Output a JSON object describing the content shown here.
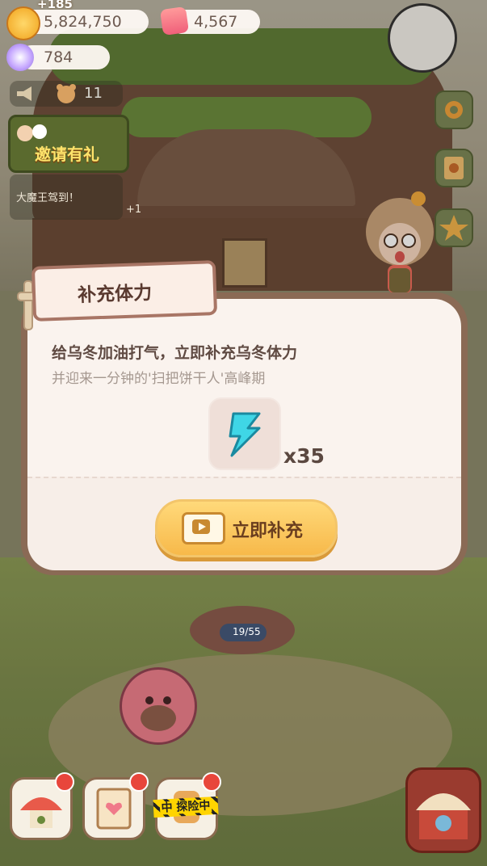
{
  "resources": {
    "gain_popup": "+185",
    "coins": "5,824,750",
    "gems": "4,567",
    "orbs": "784"
  },
  "left_panel": {
    "notice_count": "11",
    "invite_label": "邀请有礼",
    "chat_message": "大魔王驾到！",
    "chat_plus": "+1"
  },
  "dialog": {
    "title": "补充体力",
    "description": "给乌冬加油打气，立即补充乌冬体力",
    "sub_description": "并迎来一分钟的'扫把饼干人'高峰期",
    "item_icon": "lightning-bolt-icon",
    "quantity": "x35",
    "refill_button_label": "立即补充"
  },
  "stage": {
    "progress": "19/55"
  },
  "bottom_bar": {
    "explore_tape": "中 探险中"
  },
  "colors": {
    "dialog_bg": "#faf3ee",
    "button_gold": "#f7b94a",
    "badge_red": "#e8463b"
  }
}
